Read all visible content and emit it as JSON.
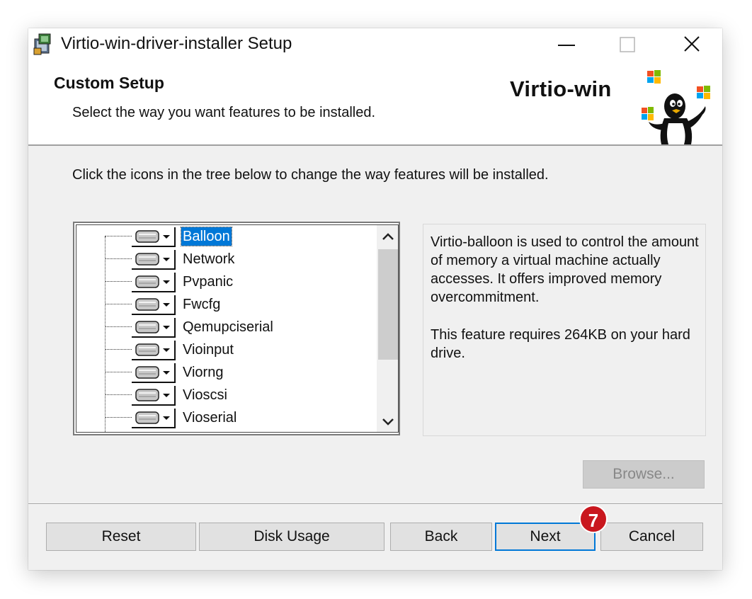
{
  "window": {
    "title": "Virtio-win-driver-installer Setup"
  },
  "banner": {
    "title": "Custom Setup",
    "subtitle": "Select the way you want features to be installed.",
    "brand": "Virtio-win"
  },
  "instructions": "Click the icons in the tree below to change the way features will be installed.",
  "tree": {
    "selected_index": 0,
    "items": [
      {
        "label": "Balloon"
      },
      {
        "label": "Network"
      },
      {
        "label": "Pvpanic"
      },
      {
        "label": "Fwcfg"
      },
      {
        "label": "Qemupciserial"
      },
      {
        "label": "Vioinput"
      },
      {
        "label": "Viorng"
      },
      {
        "label": "Vioscsi"
      },
      {
        "label": "Vioserial"
      }
    ]
  },
  "description": {
    "text": "Virtio-balloon is used to control the amount of memory a virtual machine actually accesses. It offers improved memory overcommitment.",
    "size_note": "This feature requires 264KB on your hard drive."
  },
  "buttons": {
    "browse": "Browse...",
    "reset": "Reset",
    "disk_usage": "Disk Usage",
    "back": "Back",
    "next": "Next",
    "cancel": "Cancel"
  },
  "step_badge": "7",
  "colors": {
    "accent": "#0078d7",
    "badge": "#c9171e",
    "window_bg": "#f0f0f0"
  },
  "icons": [
    "installer-app-icon",
    "minimize-icon",
    "maximize-icon",
    "close-icon",
    "drive-feature-icon",
    "dropdown-arrow-icon",
    "scroll-up-arrow-icon",
    "scroll-down-arrow-icon",
    "tux-windows-logo"
  ]
}
